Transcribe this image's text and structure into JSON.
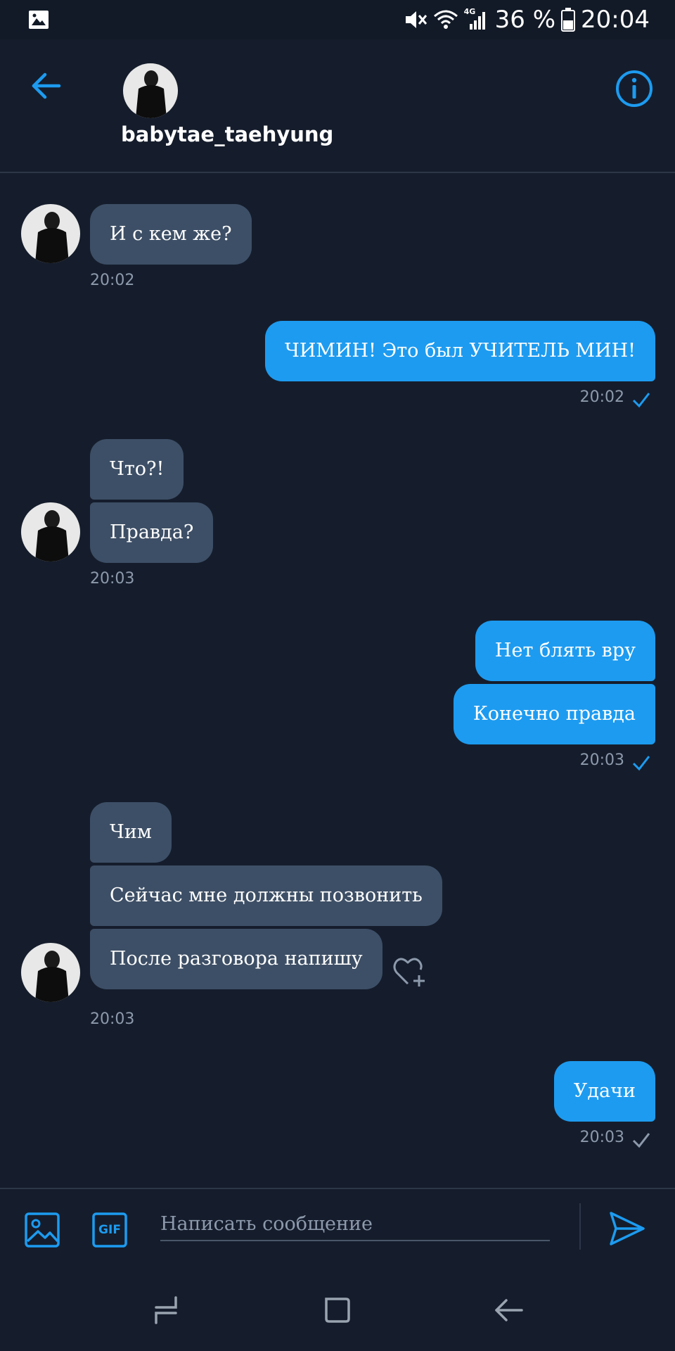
{
  "status_bar": {
    "battery": "36 %",
    "time": "20:04",
    "network": "4G"
  },
  "header": {
    "username": "babytae_taehyung",
    "icons": [
      "back-arrow-icon",
      "info-icon"
    ]
  },
  "messages": [
    {
      "side": "in",
      "texts": [
        "И с кем же?"
      ],
      "time": "20:02"
    },
    {
      "side": "out",
      "texts": [
        "ЧИМИН! Это был УЧИТЕЛЬ МИН!"
      ],
      "time": "20:02"
    },
    {
      "side": "in",
      "texts": [
        "Что?!",
        "Правда?"
      ],
      "time": "20:03"
    },
    {
      "side": "out",
      "texts": [
        "Нет блять вру",
        "Конечно правда"
      ],
      "time": "20:03"
    },
    {
      "side": "in",
      "texts": [
        "Чим",
        "Сейчас мне должны позвонить",
        "После разговора напишу"
      ],
      "time": "20:03"
    },
    {
      "side": "out",
      "texts": [
        "Удачи"
      ],
      "time": "20:03"
    }
  ],
  "composer": {
    "placeholder": "Написать сообщение",
    "gif_label": "GIF"
  },
  "colors": {
    "background": "#151d2c",
    "incoming_bubble": "#3d4f66",
    "outgoing_bubble": "#1d9bf0",
    "accent": "#1d9bf0"
  }
}
